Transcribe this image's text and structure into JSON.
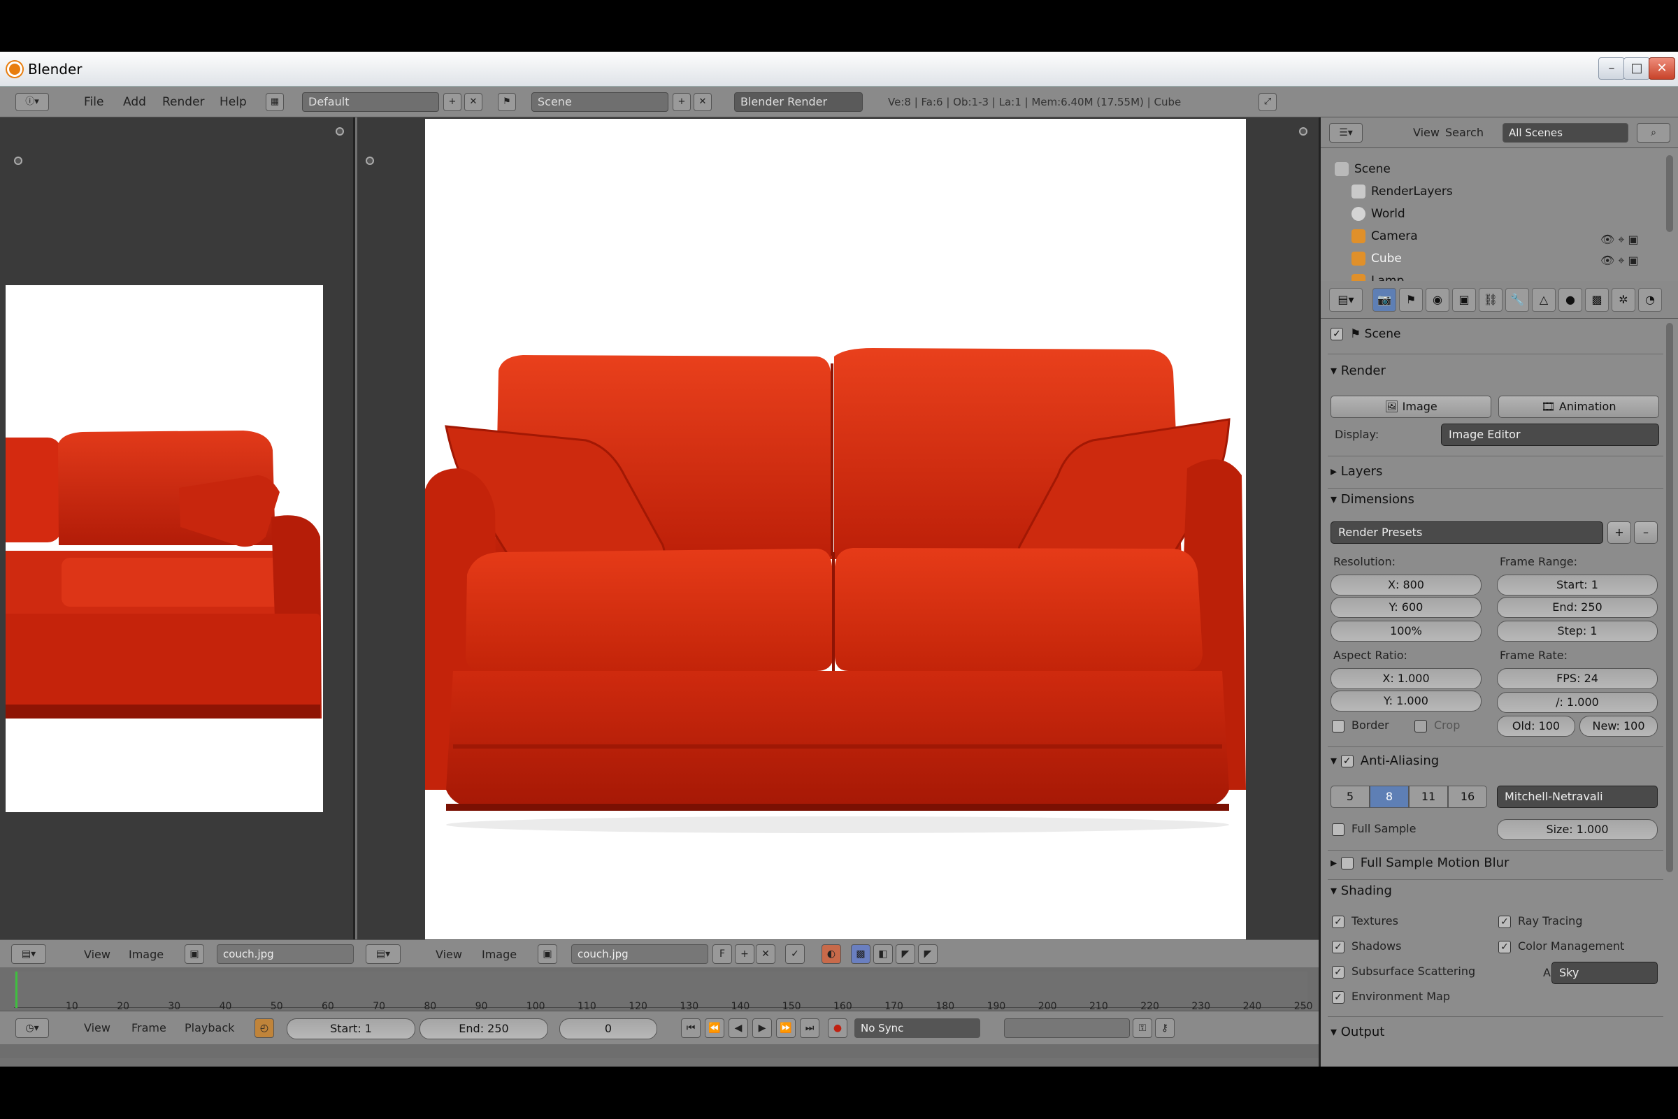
{
  "window": {
    "title": "Blender"
  },
  "menu": {
    "file": "File",
    "add": "Add",
    "render": "Render",
    "help": "Help"
  },
  "header": {
    "layout": "Default",
    "scene": "Scene",
    "engine": "Blender Render",
    "stats": "Ve:8 | Fa:6 | Ob:1-3 | La:1 | Mem:6.40M (17.55M) | Cube"
  },
  "left_editor": {
    "view": "View",
    "image": "Image",
    "image_name": "couch.jpg"
  },
  "main_editor": {
    "view": "View",
    "image": "Image",
    "image_name": "couch.jpg",
    "frame_flag": "F"
  },
  "timeline": {
    "ticks": [
      "10",
      "20",
      "30",
      "40",
      "50",
      "60",
      "70",
      "80",
      "90",
      "100",
      "110",
      "120",
      "130",
      "140",
      "150",
      "160",
      "170",
      "180",
      "190",
      "200",
      "210",
      "220",
      "230",
      "240",
      "250"
    ],
    "view": "View",
    "frame": "Frame",
    "playback": "Playback",
    "start": "Start: 1",
    "end": "End: 250",
    "current": "0",
    "sync": "No Sync"
  },
  "outliner": {
    "view": "View",
    "search": "Search",
    "filter": "All Scenes",
    "items": [
      "Scene",
      "RenderLayers",
      "World",
      "Camera",
      "Cube",
      "Lamp"
    ]
  },
  "properties": {
    "context": "Scene",
    "render": {
      "title": "Render",
      "image": "Image",
      "animation": "Animation",
      "display_label": "Display:",
      "display": "Image Editor"
    },
    "layers": "Layers",
    "dimensions": {
      "title": "Dimensions",
      "presets": "Render Presets",
      "resolution": "Resolution:",
      "res_x": "X: 800",
      "res_y": "Y: 600",
      "res_pct": "100%",
      "frame_range": "Frame Range:",
      "start": "Start: 1",
      "end": "End: 250",
      "step": "Step: 1",
      "aspect": "Aspect Ratio:",
      "asp_x": "X: 1.000",
      "asp_y": "Y: 1.000",
      "frame_rate": "Frame Rate:",
      "fps": "FPS: 24",
      "fps_base": "/: 1.000",
      "border": "Border",
      "crop": "Crop",
      "old": "Old: 100",
      "new": "New: 100"
    },
    "anti_aliasing": {
      "title": "Anti-Aliasing",
      "samples": [
        "5",
        "8",
        "11",
        "16"
      ],
      "filter": "Mitchell-Netravali",
      "full_sample": "Full Sample",
      "size": "Size: 1.000"
    },
    "motion_blur": "Full Sample Motion Blur",
    "shading": {
      "title": "Shading",
      "textures": "Textures",
      "ray_tracing": "Ray Tracing",
      "shadows": "Shadows",
      "color_management": "Color Management",
      "sss": "Subsurface Scattering",
      "alpha_label": "Alpha:",
      "alpha": "Sky",
      "env_map": "Environment Map"
    },
    "output": "Output"
  },
  "colors": {
    "sofa": "#d2260e",
    "sofa_dark": "#8e1404",
    "accent": "#5e7fb5"
  }
}
